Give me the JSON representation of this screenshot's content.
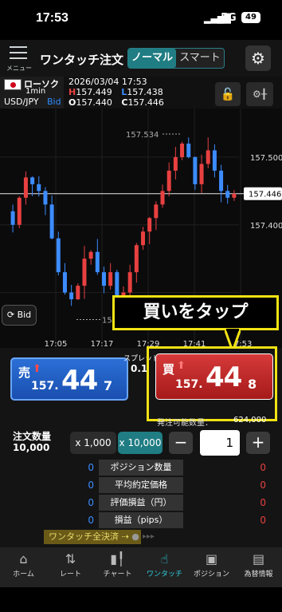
{
  "status": {
    "time": "17:53",
    "network": "5G",
    "battery": "49"
  },
  "header": {
    "menu_label": "メニュー",
    "title": "ワンタッチ注文",
    "mode_normal": "ノーマル",
    "mode_smart": "スマート"
  },
  "info": {
    "candle_type": "ローソク",
    "timeframe": "1min",
    "pair": "USD/JPY",
    "price_side": "Bid",
    "datetime": "2026/03/04 17:53",
    "ohlc": {
      "h_label": "H",
      "h": "157.449",
      "l_label": "L",
      "l": "157.438",
      "o_label": "O",
      "o": "157.440",
      "c_label": "C",
      "c": "157.446"
    }
  },
  "chart_data": {
    "type": "candlestick",
    "yticks": [
      "157.500",
      "157.400"
    ],
    "current_price": "157.446",
    "high_marker": "157.534",
    "low_marker": "157.260",
    "xticks": [
      "17:05",
      "17:17",
      "17:29",
      "17:41",
      "17:53"
    ],
    "bid_toggle": "Bid"
  },
  "callout": "買いをタップ",
  "order": {
    "sell_label": "売",
    "sell_small": "157.",
    "sell_big": "44",
    "sell_frac": "7",
    "buy_label": "買",
    "buy_small": "157.",
    "buy_big": "44",
    "buy_frac": "8",
    "spread_label": "スプレッド",
    "spread_value": "0.1",
    "available_label": "発注可能数量：",
    "available_value": "624,000",
    "qty_label": "注文数量",
    "qty_unit": "10,000",
    "lot_small": "x 1,000",
    "lot_large": "x 10,000",
    "minus": "−",
    "qty_value": "1",
    "plus": "+"
  },
  "stats": [
    {
      "left": "0",
      "label": "ポジション数量",
      "right": "0"
    },
    {
      "left": "0",
      "label": "平均約定価格",
      "right": "0"
    },
    {
      "left": "0",
      "label": "評価損益（円）",
      "right": "0"
    },
    {
      "left": "0",
      "label": "損益（pips）",
      "right": "0"
    }
  ],
  "close_all": "ワンタッチ全決済",
  "nav": [
    {
      "label": "ホーム",
      "icon": "home-icon"
    },
    {
      "label": "レート",
      "icon": "rate-icon"
    },
    {
      "label": "チャート",
      "icon": "chart-icon"
    },
    {
      "label": "ワンタッチ",
      "icon": "one-touch-icon"
    },
    {
      "label": "ポジション",
      "icon": "position-icon"
    },
    {
      "label": "為替情報",
      "icon": "news-icon"
    }
  ]
}
